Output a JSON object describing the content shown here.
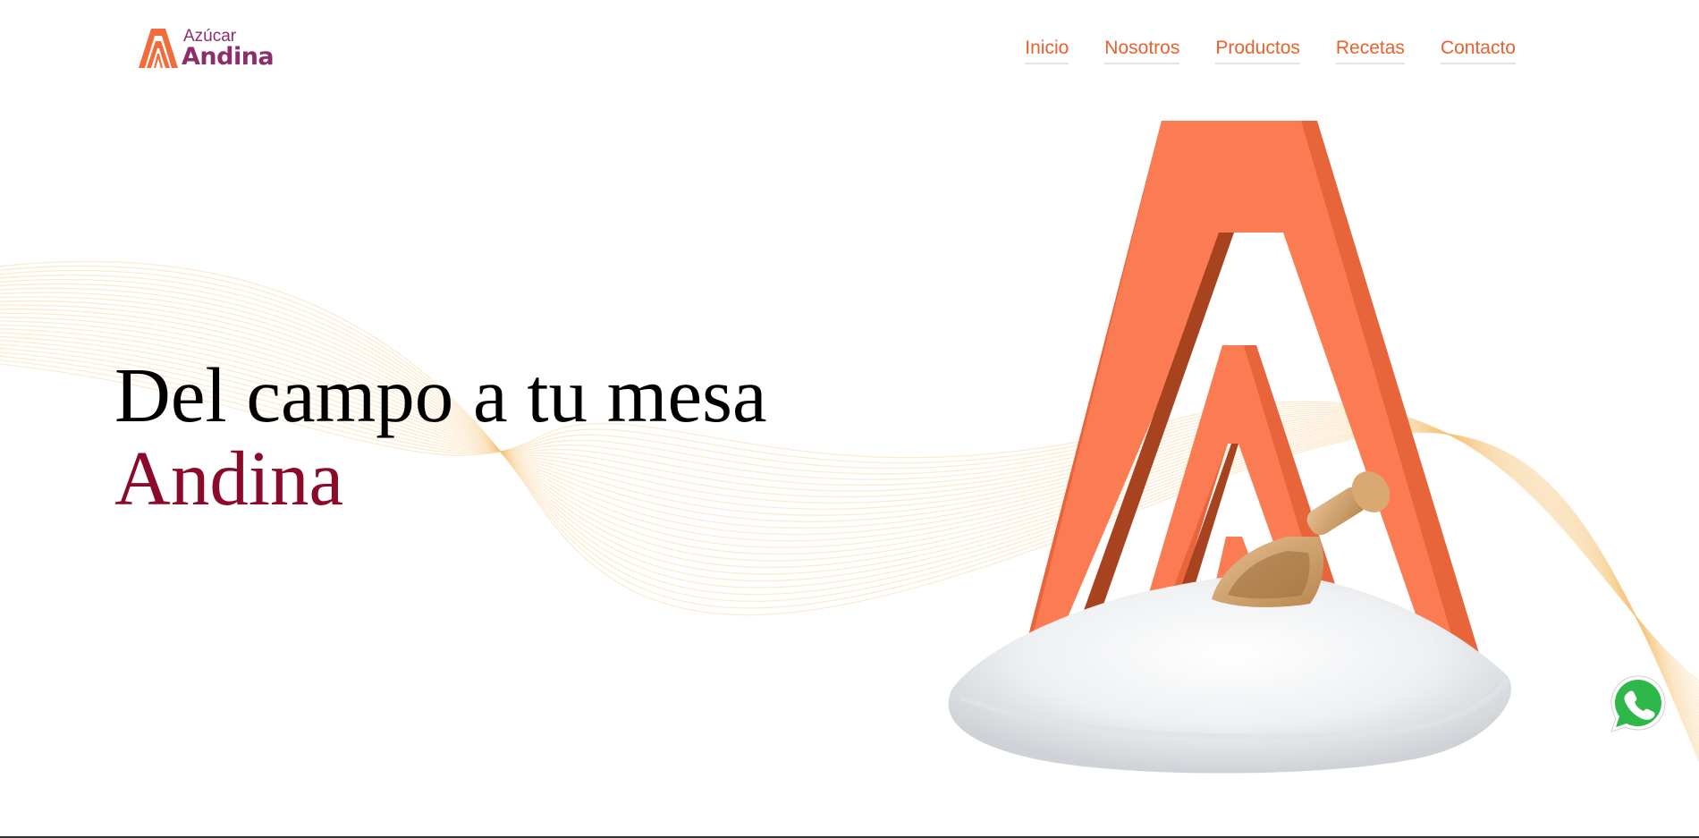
{
  "brand": {
    "top": "Azúcar",
    "bottom": "Andina",
    "primary_color": "#8b2e6b",
    "accent_color": "#f26b3a"
  },
  "nav": {
    "items": [
      {
        "label": "Inicio"
      },
      {
        "label": "Nosotros"
      },
      {
        "label": "Productos"
      },
      {
        "label": "Recetas"
      },
      {
        "label": "Contacto"
      }
    ],
    "color": "#e8622c"
  },
  "hero": {
    "title_line1": "Del campo a tu mesa",
    "title_line2": "Andina",
    "accent_color": "#8b0a2a",
    "image": "orange-letter-a-with-sugar-pile-and-wooden-scoop"
  },
  "floating": {
    "whatsapp_icon": "whatsapp-icon"
  }
}
